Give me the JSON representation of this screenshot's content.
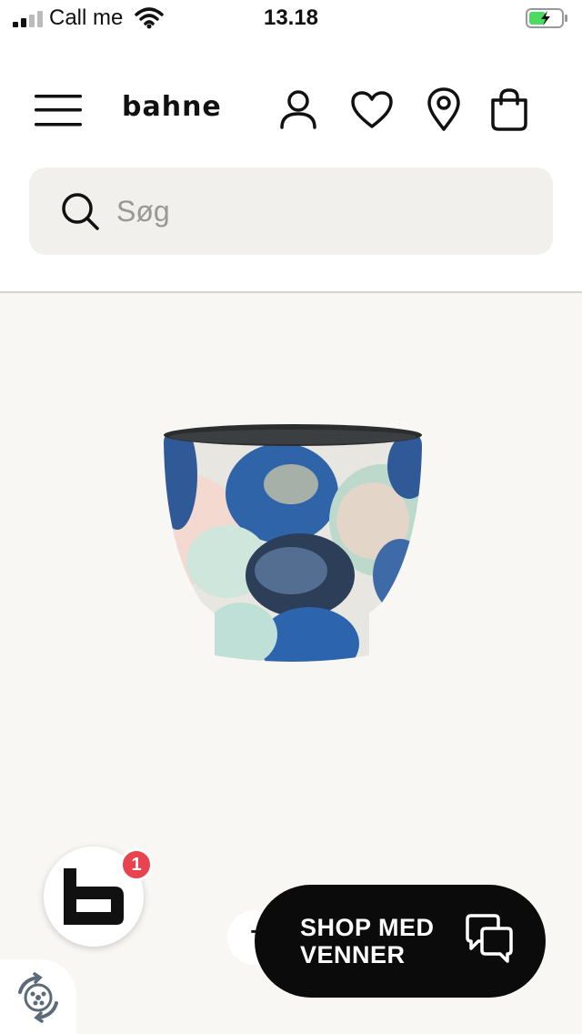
{
  "status_bar": {
    "carrier": "Call me",
    "time": "13.18",
    "signal_icon": "signal-bars-icon",
    "wifi_icon": "wifi-icon",
    "battery_icon": "battery-charging-icon"
  },
  "header": {
    "logo": "bahne",
    "icons": [
      "menu-icon",
      "account-icon",
      "wishlist-heart-icon",
      "store-locator-icon",
      "shopping-bag-icon"
    ]
  },
  "search": {
    "placeholder": "Søg",
    "value": ""
  },
  "floating": {
    "notification_count": "1",
    "partial_button_letter": "T",
    "shop_label_line1": "SHOP MED",
    "shop_label_line2": "VENNER"
  },
  "colors": {
    "notification": "#e8434f",
    "shop_button": "#0b0b0b",
    "search_bg": "#f2f0ed",
    "product_bg": "#f8f7f4"
  }
}
